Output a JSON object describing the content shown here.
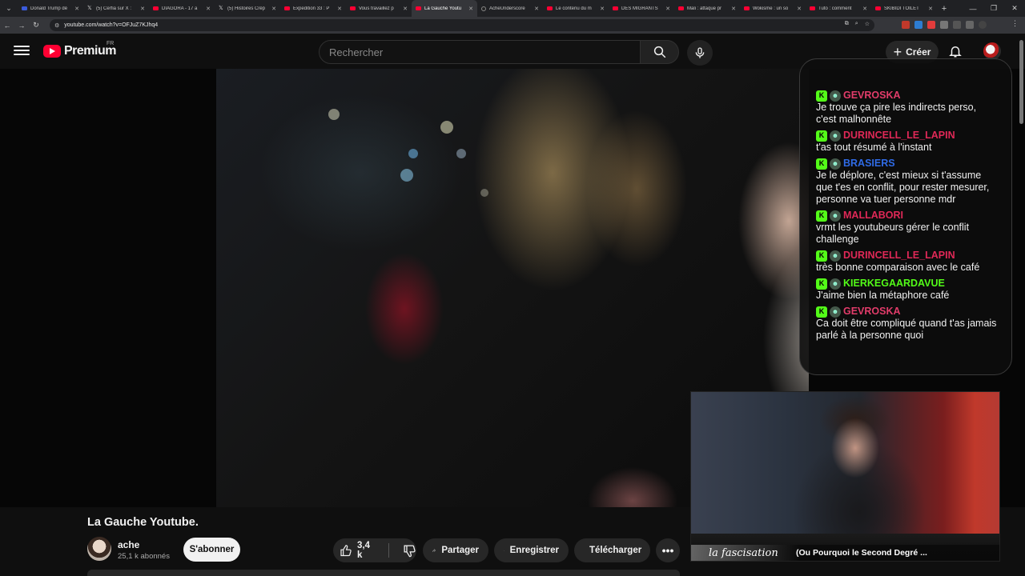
{
  "browser": {
    "tabs": [
      {
        "title": "Donald Trump dé",
        "icon": "blue"
      },
      {
        "title": "(5) Cerfia sur X :",
        "icon": "x"
      },
      {
        "title": "DIAGORA - 17 a",
        "icon": "yt"
      },
      {
        "title": "(5) Histoires Crép",
        "icon": "x"
      },
      {
        "title": "Expedition 33 : P",
        "icon": "yt"
      },
      {
        "title": "Vous travaillez p",
        "icon": "yt"
      },
      {
        "title": "La Gauche Youtu",
        "icon": "yt",
        "active": true
      },
      {
        "title": "AcheUnderscore",
        "icon": "dark"
      },
      {
        "title": "Le contenu du m",
        "icon": "yt"
      },
      {
        "title": "DES MIGRANTS",
        "icon": "yt"
      },
      {
        "title": "Mali : attaque pr",
        "icon": "yt"
      },
      {
        "title": "Wokisme : un so",
        "icon": "yt"
      },
      {
        "title": "Tuto : comment",
        "icon": "yt"
      },
      {
        "title": "SKIBIDI TOILET",
        "icon": "yt"
      }
    ],
    "url": "youtube.com/watch?v=OFJuZ7KJhq4"
  },
  "header": {
    "logo_text": "Premium",
    "region": "FR",
    "search_placeholder": "Rechercher",
    "create_label": "Créer"
  },
  "chat": {
    "messages": [
      {
        "user": "GEVROSKA",
        "color": "#e23c6a",
        "text": "Je trouve ça pire les indirects perso, c'est malhonnête"
      },
      {
        "user": "DURINCELL_LE_LAPIN",
        "color": "#e02857",
        "text": "t'as tout résumé à l'instant"
      },
      {
        "user": "BRASIERS",
        "color": "#2f6be6",
        "text": "Je le déplore, c'est mieux si t'assume que t'es en conflit, pour rester mesurer, personne va tuer personne mdr"
      },
      {
        "user": "MALLABORI",
        "color": "#e02857",
        "text": "vrmt les youtubeurs gérer le conflit challenge"
      },
      {
        "user": "DURINCELL_LE_LAPIN",
        "color": "#e02857",
        "text": "très bonne comparaison avec le café"
      },
      {
        "user": "KIERKEGAARDAVUE",
        "color": "#53fc18",
        "text": "J'aime bien la métaphore café"
      },
      {
        "user": "GEVROSKA",
        "color": "#e23c6a",
        "text": "Ca doit être compliqué quand t'as jamais parlé à la personne quoi"
      }
    ]
  },
  "webcam": {
    "brand": "la fascisation",
    "ticker_title": "(Ou Pourquoi le Second Degré ..."
  },
  "video": {
    "title": "La Gauche Youtube.",
    "channel": "ache",
    "subscribers": "25,1 k abonnés",
    "subscribe_label": "S'abonner",
    "likes": "3,4 k",
    "share_label": "Partager",
    "save_label": "Enregistrer",
    "download_label": "Télécharger"
  }
}
